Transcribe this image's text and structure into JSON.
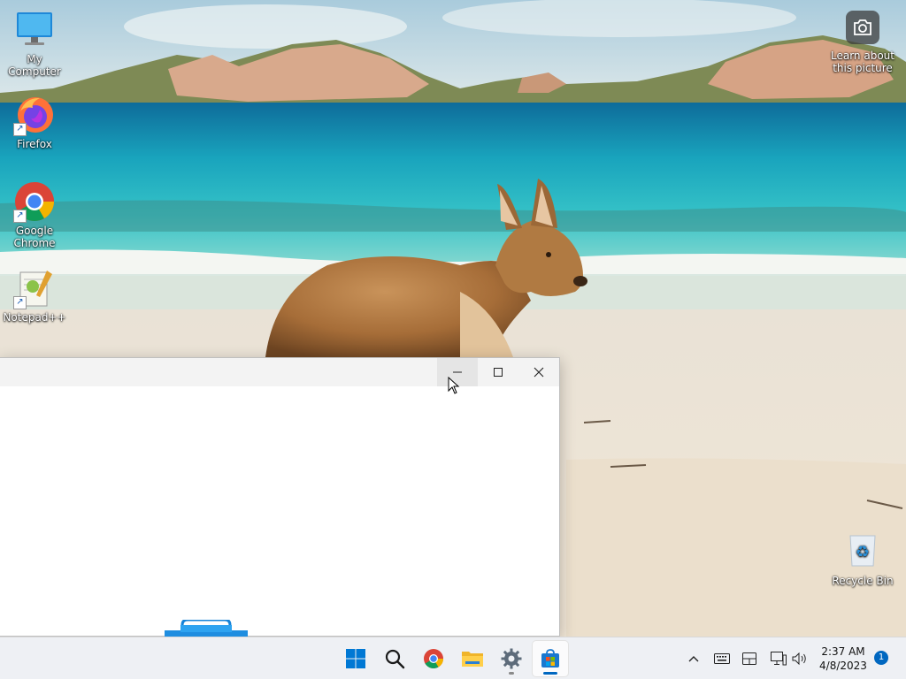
{
  "desktop": {
    "icons": [
      {
        "label": "My Computer",
        "icon": "monitor-icon"
      },
      {
        "label": "Firefox",
        "icon": "firefox-icon"
      },
      {
        "label": "Google Chrome",
        "icon": "chrome-icon"
      },
      {
        "label": "Notepad++",
        "icon": "notepadpp-icon"
      },
      {
        "label": "Recycle Bin",
        "icon": "recycle-bin-icon"
      }
    ],
    "learn_about": {
      "label": "Learn about this picture",
      "icon": "camera-icon"
    }
  },
  "window": {
    "controls": {
      "minimize": "minimize-icon",
      "maximize": "maximize-icon",
      "close": "close-icon"
    }
  },
  "taskbar": {
    "apps": [
      {
        "name": "Start",
        "icon": "windows-start-icon"
      },
      {
        "name": "Search",
        "icon": "search-icon"
      },
      {
        "name": "Google Chrome",
        "icon": "chrome-icon"
      },
      {
        "name": "File Explorer",
        "icon": "folder-icon"
      },
      {
        "name": "Settings",
        "icon": "gear-icon"
      },
      {
        "name": "Microsoft Store",
        "icon": "store-icon",
        "active": true
      }
    ],
    "tray": {
      "icons": [
        "chevron-up-icon",
        "keyboard-icon",
        "tablet-icon",
        "network-icon",
        "volume-icon"
      ],
      "time": "2:37 AM",
      "date": "4/8/2023",
      "notification_count": "1"
    }
  },
  "colors": {
    "accent": "#0067c0",
    "taskbar": "#eef0f4",
    "titlebar": "#f3f3f3"
  }
}
